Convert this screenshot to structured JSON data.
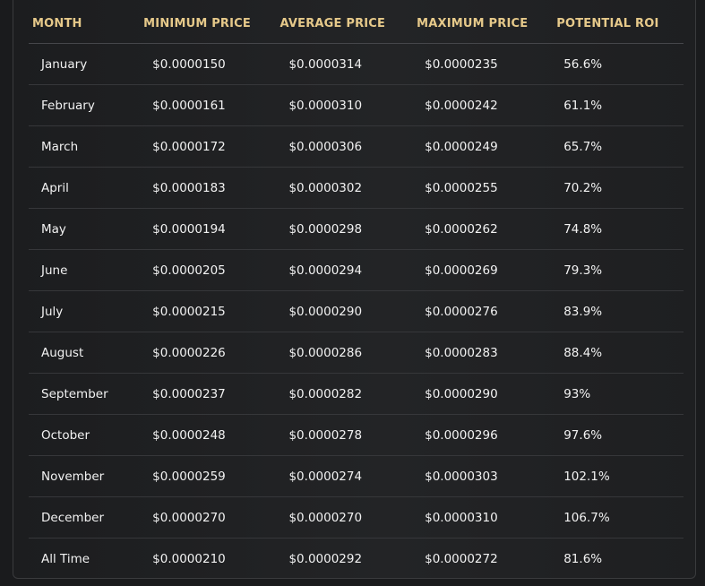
{
  "table": {
    "headers": [
      "MONTH",
      "MINIMUM PRICE",
      "AVERAGE PRICE",
      "MAXIMUM PRICE",
      "POTENTIAL ROI"
    ],
    "rows": [
      [
        "January",
        "$0.0000150",
        "$0.0000314",
        "$0.0000235",
        "56.6%"
      ],
      [
        "February",
        "$0.0000161",
        "$0.0000310",
        "$0.0000242",
        "61.1%"
      ],
      [
        "March",
        "$0.0000172",
        "$0.0000306",
        "$0.0000249",
        "65.7%"
      ],
      [
        "April",
        "$0.0000183",
        "$0.0000302",
        "$0.0000255",
        "70.2%"
      ],
      [
        "May",
        "$0.0000194",
        "$0.0000298",
        "$0.0000262",
        "74.8%"
      ],
      [
        "June",
        "$0.0000205",
        "$0.0000294",
        "$0.0000269",
        "79.3%"
      ],
      [
        "July",
        "$0.0000215",
        "$0.0000290",
        "$0.0000276",
        "83.9%"
      ],
      [
        "August",
        "$0.0000226",
        "$0.0000286",
        "$0.0000283",
        "88.4%"
      ],
      [
        "September",
        "$0.0000237",
        "$0.0000282",
        "$0.0000290",
        "93%"
      ],
      [
        "October",
        "$0.0000248",
        "$0.0000278",
        "$0.0000296",
        "97.6%"
      ],
      [
        "November",
        "$0.0000259",
        "$0.0000274",
        "$0.0000303",
        "102.1%"
      ],
      [
        "December",
        "$0.0000270",
        "$0.0000270",
        "$0.0000310",
        "106.7%"
      ],
      [
        "All Time",
        "$0.0000210",
        "$0.0000292",
        "$0.0000272",
        "81.6%"
      ]
    ]
  },
  "colors": {
    "header_text": "#e6c98a",
    "cell_text": "#f2f2f2",
    "background": "#202123",
    "row_divider": "#36373a"
  }
}
